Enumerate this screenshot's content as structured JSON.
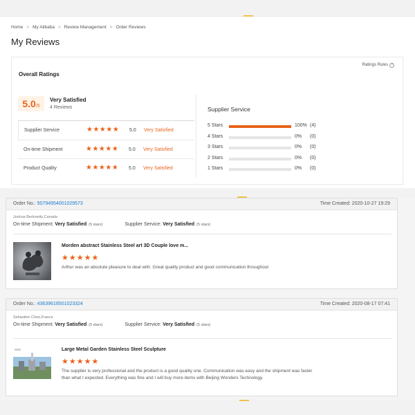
{
  "breadcrumb": [
    "Home",
    "My Alibaba",
    "Review Management",
    "Order Reviews"
  ],
  "page_title": "My Reviews",
  "overall": {
    "heading": "Overall Ratings",
    "rules_label": "Ratings Rules",
    "score": "5.0",
    "score_out_of": "/5",
    "score_label": "Very Satisfied",
    "review_count": "4 Reviews",
    "metrics": [
      {
        "name": "Supplier Service",
        "stars": "★★★★★",
        "value": "5.0",
        "desc": "Very Satisfied"
      },
      {
        "name": "On-time Shipment",
        "stars": "★★★★★",
        "value": "5.0",
        "desc": "Very Satisfied"
      },
      {
        "name": "Product Quality",
        "stars": "★★★★★",
        "value": "5.0",
        "desc": "Very Satisfied"
      }
    ],
    "supplier_service_title": "Supplier Service",
    "distribution": [
      {
        "label": "5 Stars",
        "fraction": 1.0,
        "percent": "100%",
        "count": "(4)"
      },
      {
        "label": "4 Stars",
        "fraction": 0,
        "percent": "0%",
        "count": "(0)"
      },
      {
        "label": "3 Stars",
        "fraction": 0,
        "percent": "0%",
        "count": "(0)"
      },
      {
        "label": "2 Stars",
        "fraction": 0,
        "percent": "0%",
        "count": "(0)"
      },
      {
        "label": "1 Stars",
        "fraction": 0,
        "percent": "0%",
        "count": "(0)"
      }
    ]
  },
  "orders": [
    {
      "order_label": "Order No.:",
      "order_no": "50794954001029573",
      "time_created": "Time Created: 2020-10-27 19:29",
      "buyer": "Joshua Berkowitz,Canada",
      "shipment_label": "On-time Shipment:",
      "shipment_value": "Very Satisfied",
      "shipment_stars": "(5 stars)",
      "service_label": "Supplier Service:",
      "service_value": "Very Satisfied",
      "service_stars": "(5 stars)",
      "product_title": "Morden abstract Stainless Steel art 3D Couple love m...",
      "stars": "★★★★★",
      "review": "Arthur was an absolute pleasure to deal with. Great quality product and good communication throughout"
    },
    {
      "order_label": "Order No.:",
      "order_no": "43639618501023324",
      "time_created": "Time Created: 2020-08-17 07:41",
      "buyer": "Sebastien Chee,France",
      "shipment_label": "On-time Shipment:",
      "shipment_value": "Very Satisfied",
      "shipment_stars": "(5 stars)",
      "service_label": "Supplier Service:",
      "service_value": "Very Satisfied",
      "service_stars": "(5 stars)",
      "product_title": "Large Metal Garden Stainless Steel Sculpture",
      "stars": "★★★★★",
      "review": "The supplier is very professional and the product is a good quality one. Communication was easy and the shipment was faster than what I expected. Everything was fine and I will buy more items with Beijing Wonders Technology."
    }
  ],
  "colors": {
    "accent": "#e8641b",
    "link": "#1a7ccf"
  }
}
